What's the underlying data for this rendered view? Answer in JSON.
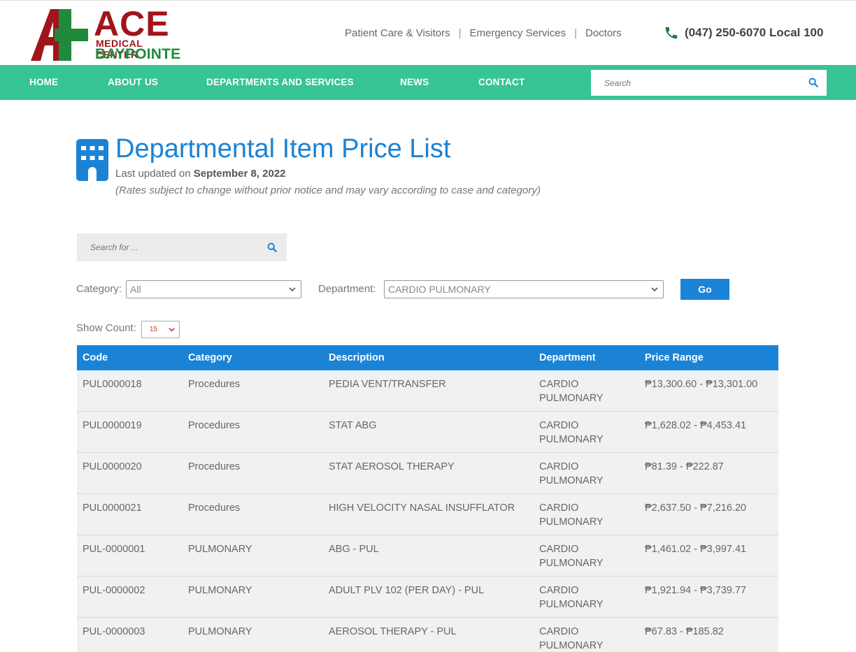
{
  "header": {
    "logo": {
      "name": "ACE",
      "line2": "MEDICAL CENTER",
      "line3": "BAYPOINTE",
      "colors": {
        "red": "#a0151c",
        "green": "#1f8a3b"
      }
    },
    "top_links": [
      "Patient Care & Visitors",
      "Emergency Services",
      "Doctors"
    ],
    "phone": "(047) 250-6070 Local 100"
  },
  "nav": {
    "items": [
      "HOME",
      "ABOUT US",
      "DEPARTMENTS AND SERVICES",
      "NEWS",
      "CONTACT"
    ],
    "search_placeholder": "Search",
    "color": "#37c497"
  },
  "page": {
    "title": "Departmental Item Price List",
    "updated_prefix": "Last updated on",
    "updated_date": "September 8, 2022",
    "note": "(Rates subject to change without prior notice and may vary according to case and category)",
    "title_color": "#1a83d6",
    "icon": "building-icon"
  },
  "filters": {
    "search_placeholder": "Search for ...",
    "category_label": "Category:",
    "category_value": "All",
    "department_label": "Department:",
    "department_value": "CARDIO PULMONARY",
    "go_label": "Go",
    "count_label": "Show Count:",
    "count_value": "15"
  },
  "table": {
    "columns": [
      "Code",
      "Category",
      "Description",
      "Department",
      "Price Range"
    ],
    "rows": [
      [
        "PUL0000018",
        "Procedures",
        "PEDIA VENT/TRANSFER",
        "CARDIO PULMONARY",
        "₱13,300.60 - ₱13,301.00"
      ],
      [
        "PUL0000019",
        "Procedures",
        "STAT ABG",
        "CARDIO PULMONARY",
        "₱1,628.02 - ₱4,453.41"
      ],
      [
        "PUL0000020",
        "Procedures",
        "STAT AEROSOL THERAPY",
        "CARDIO PULMONARY",
        "₱81.39 - ₱222.87"
      ],
      [
        "PUL0000021",
        "Procedures",
        "HIGH VELOCITY NASAL INSUFFLATOR",
        "CARDIO PULMONARY",
        "₱2,637.50 - ₱7,216.20"
      ],
      [
        "PUL-0000001",
        "PULMONARY",
        "ABG - PUL",
        "CARDIO PULMONARY",
        "₱1,461.02 - ₱3,997.41"
      ],
      [
        "PUL-0000002",
        "PULMONARY",
        "ADULT PLV 102 (PER DAY) - PUL",
        "CARDIO PULMONARY",
        "₱1,921.94 - ₱3,739.77"
      ],
      [
        "PUL-0000003",
        "PULMONARY",
        "AEROSOL THERAPY - PUL",
        "CARDIO PULMONARY",
        "₱67.83 - ₱185.82"
      ]
    ]
  }
}
